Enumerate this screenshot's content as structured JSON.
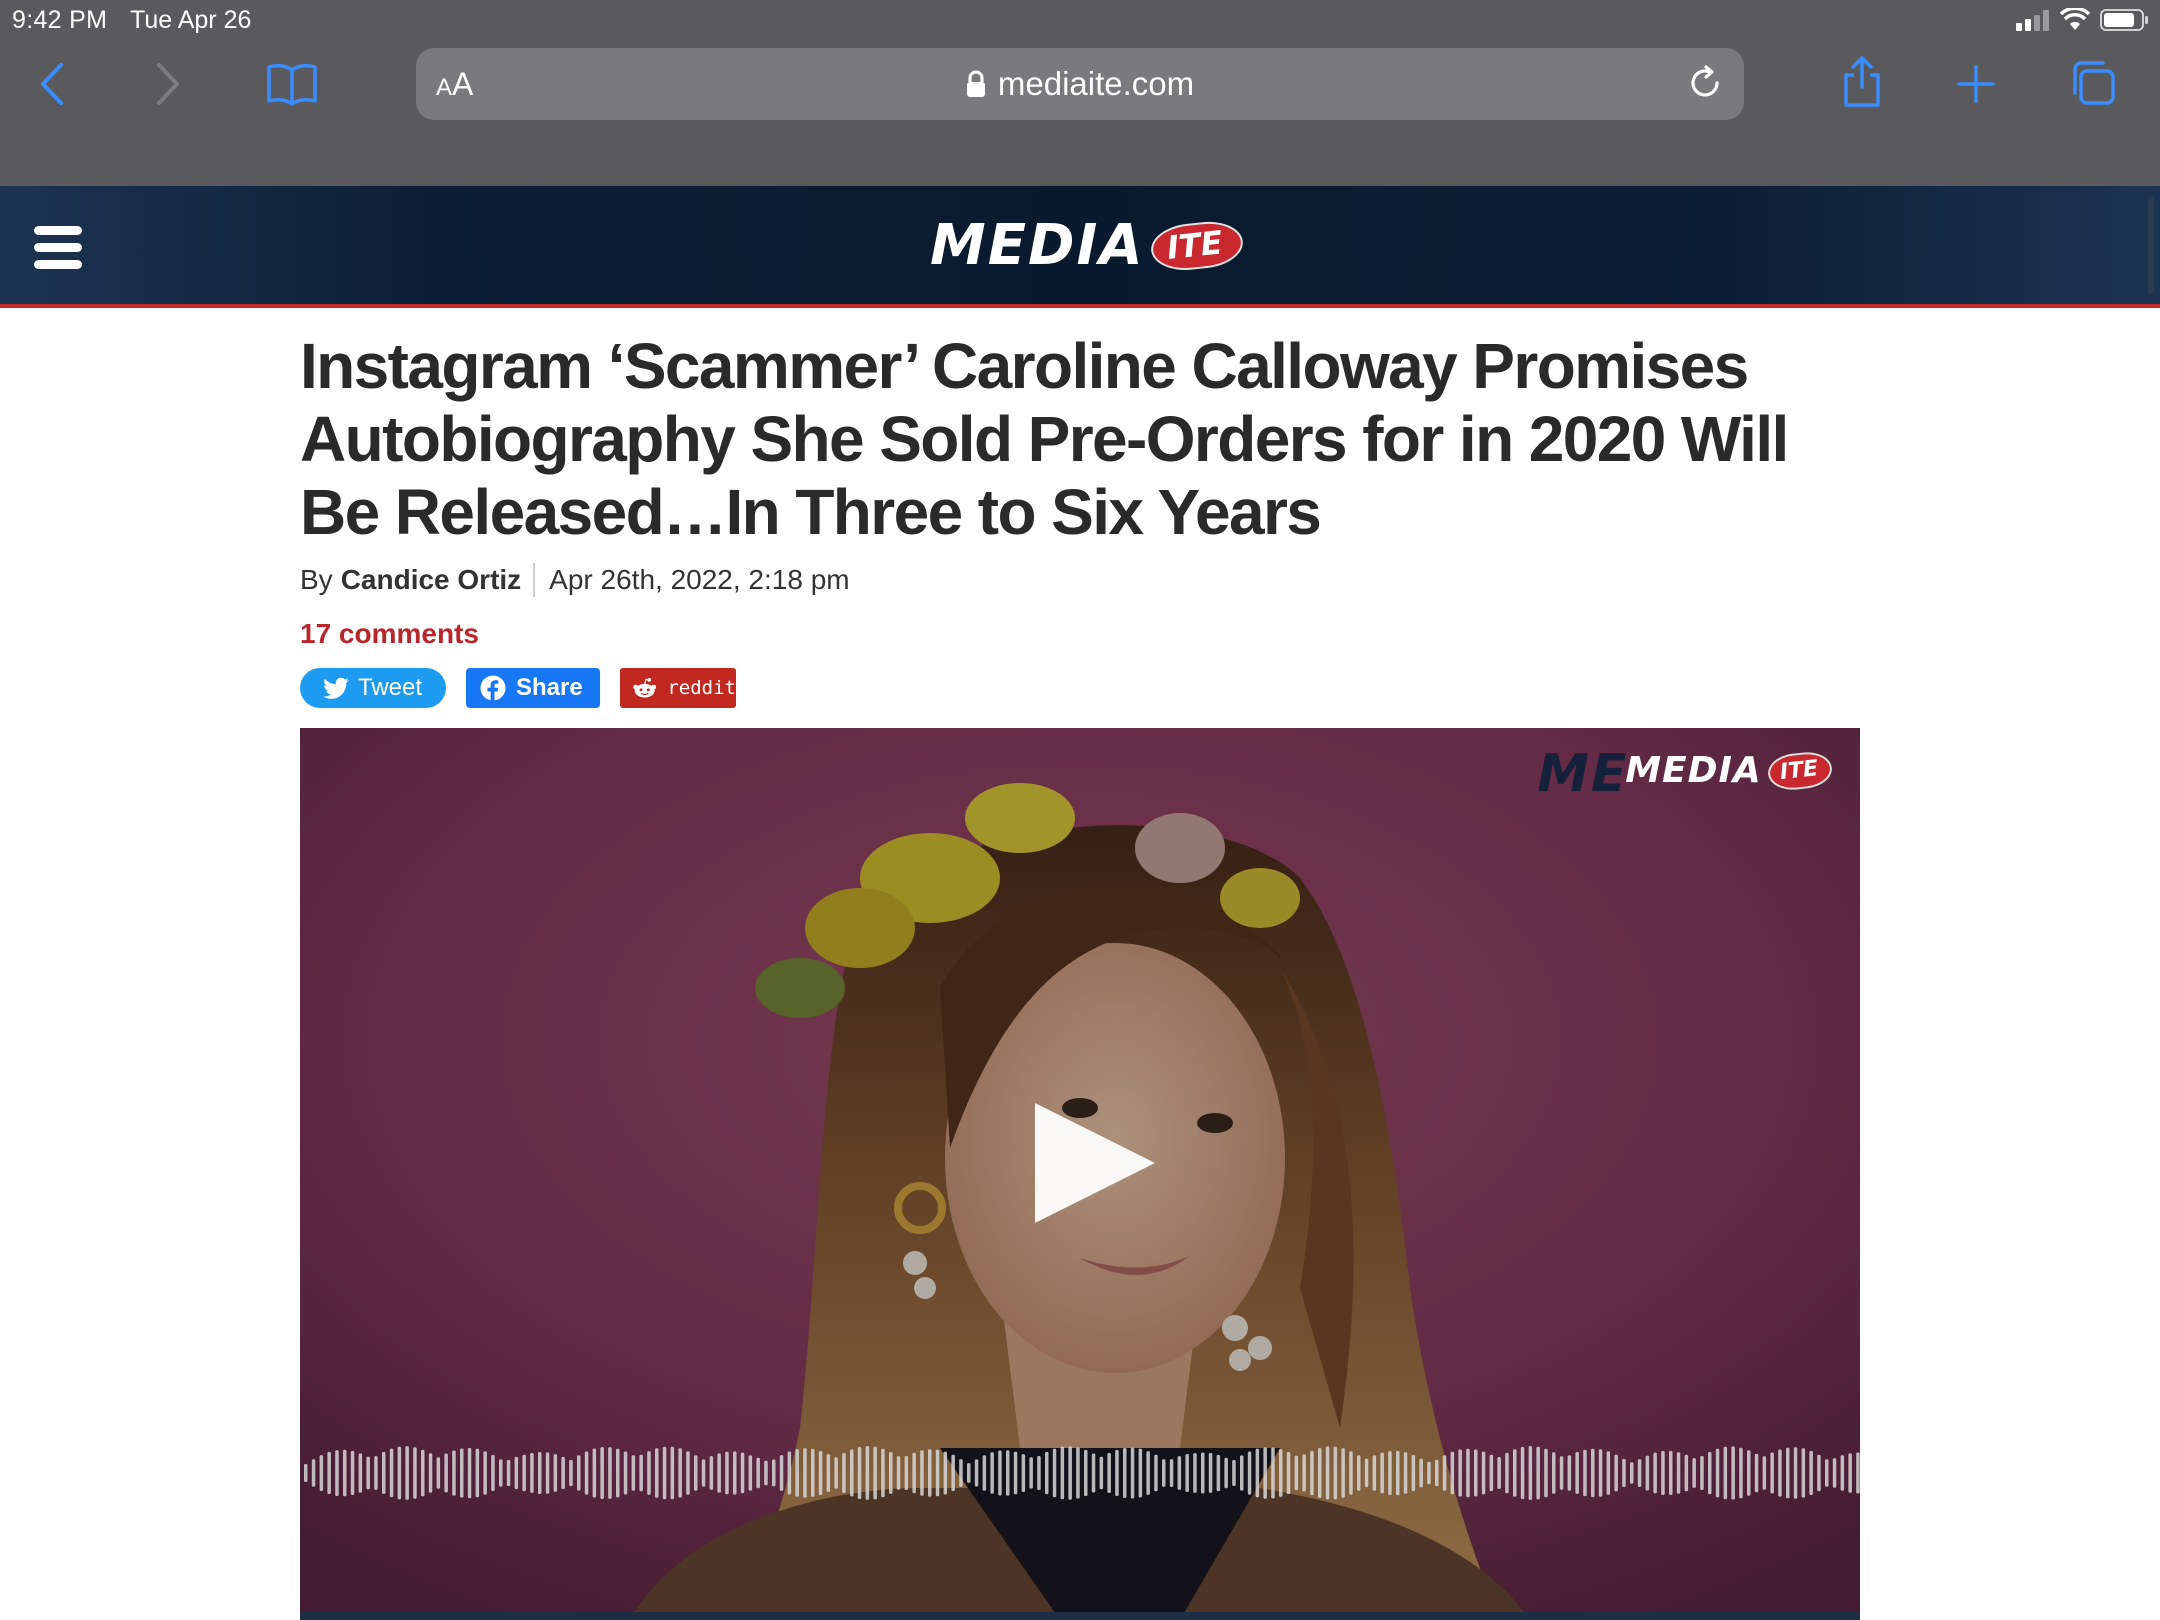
{
  "status_bar": {
    "time": "9:42 PM",
    "date": "Tue Apr 26"
  },
  "browser": {
    "text_size_label_small": "A",
    "text_size_label_large": "A",
    "url": "mediaite.com"
  },
  "site": {
    "logo_main": "MEDIA",
    "logo_badge": "ITE",
    "brand_color": "#c8282e",
    "header_color": "#0a1a2e"
  },
  "article": {
    "headline": "Instagram ‘Scammer’ Caroline Calloway Promises Autobiography She Sold Pre-Orders for in 2020 Will Be Released…In Three to Six Years",
    "byline_prefix": "By",
    "author": "Candice Ortiz",
    "date": "Apr 26th, 2022, 2:18 pm",
    "comments": "17 comments"
  },
  "share": {
    "tweet_label": "Tweet",
    "facebook_label": "Share",
    "reddit_label": "reddit"
  },
  "video": {
    "watermark_main": "MEDIA",
    "watermark_badge": "ITE",
    "watermark_ghost": "ME"
  }
}
